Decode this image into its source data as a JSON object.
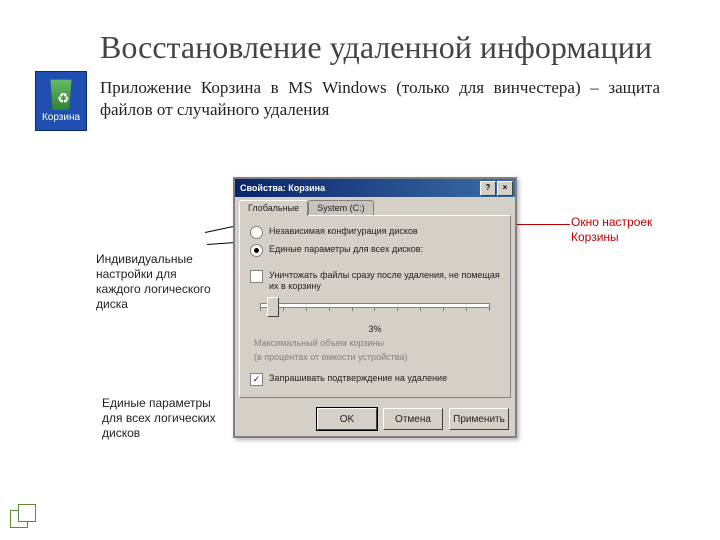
{
  "title": "Восстановление удаленной информации",
  "recycle_bin_caption": "Корзина",
  "intro_text": "Приложение Корзина в MS Windows (только для винчестера) – защита файлов от случайного удаления",
  "annotations": {
    "individual": "Индивидуальные настройки для каждого логического диска",
    "unified": "Единые параметры для всех логических дисков",
    "window": "Окно настроек Корзины"
  },
  "dialog": {
    "title": "Свойства: Корзина",
    "tabs": {
      "global": "Глобальные",
      "systemC": "System (C:)"
    },
    "radio_independent": "Независимая конфигурация дисков",
    "radio_unified": "Единые параметры для всех дисков:",
    "chk_delete_immediately": "Уничтожать файлы сразу после удаления, не помещая их в корзину",
    "slider_value": "3%",
    "slider_caption_1": "Максимальный объем корзины",
    "slider_caption_2": "(в процентах от емкости устройства)",
    "chk_confirm": "Запрашивать подтверждение на удаление",
    "buttons": {
      "ok": "OK",
      "cancel": "Отмена",
      "apply": "Применить"
    }
  }
}
